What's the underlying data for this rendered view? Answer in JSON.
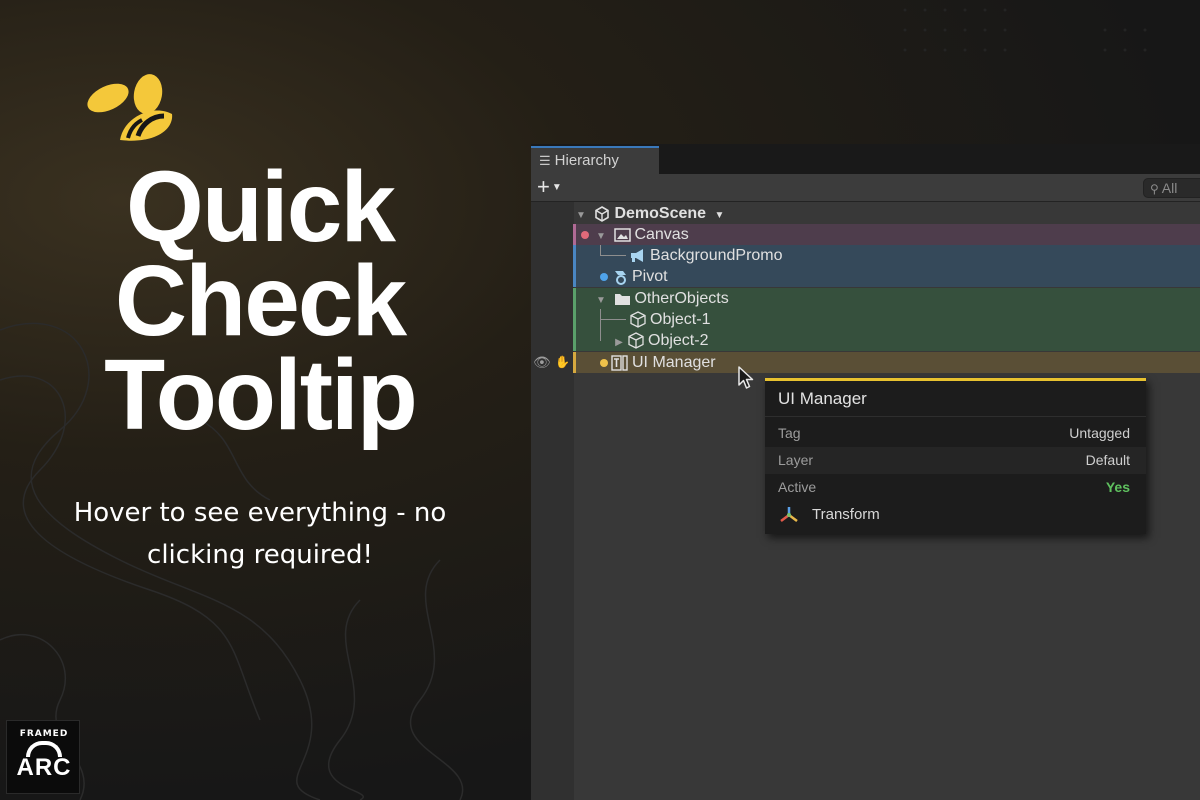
{
  "promo": {
    "headline_lines": [
      "Quick",
      "Check",
      "Tooltip"
    ],
    "subtitle": "Hover to see everything - no clicking required!",
    "brand_top": "FRAMED",
    "brand_main": "ARC"
  },
  "hierarchy": {
    "tab_label": "Hierarchy",
    "search_placeholder": "All",
    "scene": "DemoScene",
    "rows": [
      {
        "label": "Canvas",
        "color": "#8a5a7a"
      },
      {
        "label": "BackgroundPromo",
        "color": "#3f6a8f"
      },
      {
        "label": "Pivot",
        "color": "#3f6a8f"
      },
      {
        "label": "OtherObjects",
        "color": "#4a7a55"
      },
      {
        "label": "Object-1",
        "color": "#4a7a55"
      },
      {
        "label": "Object-2",
        "color": "#4a7a55"
      },
      {
        "label": "UI Manager",
        "color": "#c9a243"
      }
    ]
  },
  "tooltip": {
    "title": "UI Manager",
    "accent": "#e7c12f",
    "fields": [
      {
        "label": "Tag",
        "value": "Untagged"
      },
      {
        "label": "Layer",
        "value": "Default"
      },
      {
        "label": "Active",
        "value": "Yes"
      }
    ],
    "component": "Transform"
  }
}
